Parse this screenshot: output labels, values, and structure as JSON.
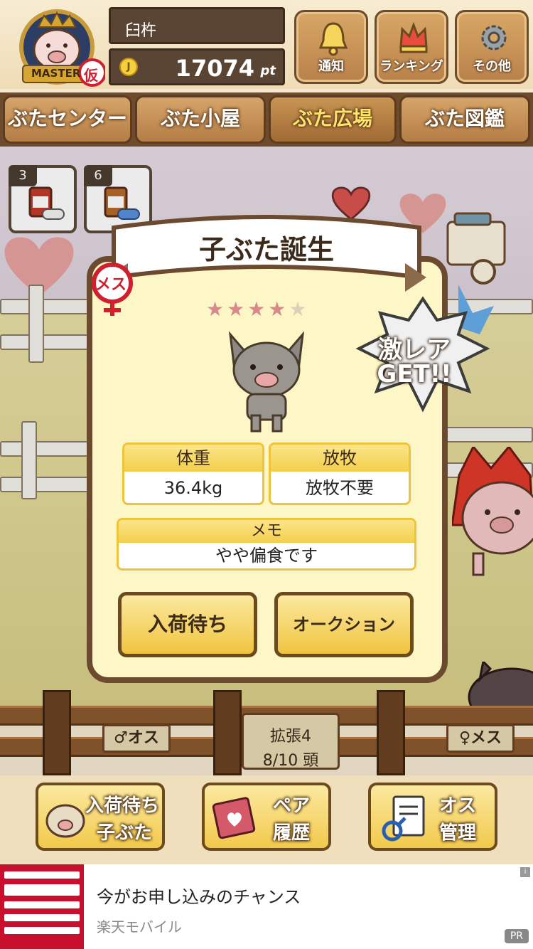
{
  "header": {
    "badge_label": "MASTER",
    "badge_kanji": "仮",
    "user_name": "臼杵",
    "points": "17074",
    "points_unit": "pt",
    "buttons": [
      {
        "label": "通知",
        "icon": "bell-icon"
      },
      {
        "label": "ランキング",
        "icon": "crown-icon"
      },
      {
        "label": "その他",
        "icon": "gear-icon"
      }
    ]
  },
  "nav": {
    "tabs": [
      {
        "label": "ぶたセンター",
        "active": false
      },
      {
        "label": "ぶた小屋",
        "active": false
      },
      {
        "label": "ぶた広場",
        "active": true
      },
      {
        "label": "ぶた図鑑",
        "active": false
      }
    ]
  },
  "items": [
    {
      "count": "3",
      "icon": "female-medicine-icon"
    },
    {
      "count": "6",
      "icon": "male-medicine-icon"
    }
  ],
  "modal": {
    "title": "子ぶた誕生",
    "gender_label": "メス",
    "stars_filled": 4,
    "stars_total": 5,
    "stars_filled_text": "★★★★",
    "stars_empty_text": "★",
    "rare_line1": "激レア",
    "rare_line2": "GET!!",
    "weight_label": "体重",
    "weight_value": "36.4kg",
    "grazing_label": "放牧",
    "grazing_value": "放牧不要",
    "memo_label": "メモ",
    "memo_value": "やや偏食です",
    "btn_wait": "入荷待ち",
    "btn_auction": "オークション"
  },
  "fence": {
    "male_sign": "♂オス",
    "female_sign": "♀メス",
    "expand_label": "拡張4",
    "capacity": "8/10 頭"
  },
  "actions": [
    {
      "line1": "入荷待ち",
      "line2": "子ぶた",
      "icon": "pig-face-icon"
    },
    {
      "line1": "ペア",
      "line2": "履歴",
      "icon": "book-heart-icon"
    },
    {
      "line1": "オス",
      "line2": "管理",
      "icon": "male-document-icon"
    }
  ],
  "ad": {
    "title": "今がお申し込みのチャンス",
    "source": "楽天モバイル",
    "pr": "PR",
    "info": "i"
  },
  "colors": {
    "wood": "#b9814a",
    "dark_wood": "#6b4a2f",
    "modal_bg": "#fdf6c6",
    "gold": "#f3cf4b",
    "star": "#d88a8a",
    "female": "#d02030"
  }
}
